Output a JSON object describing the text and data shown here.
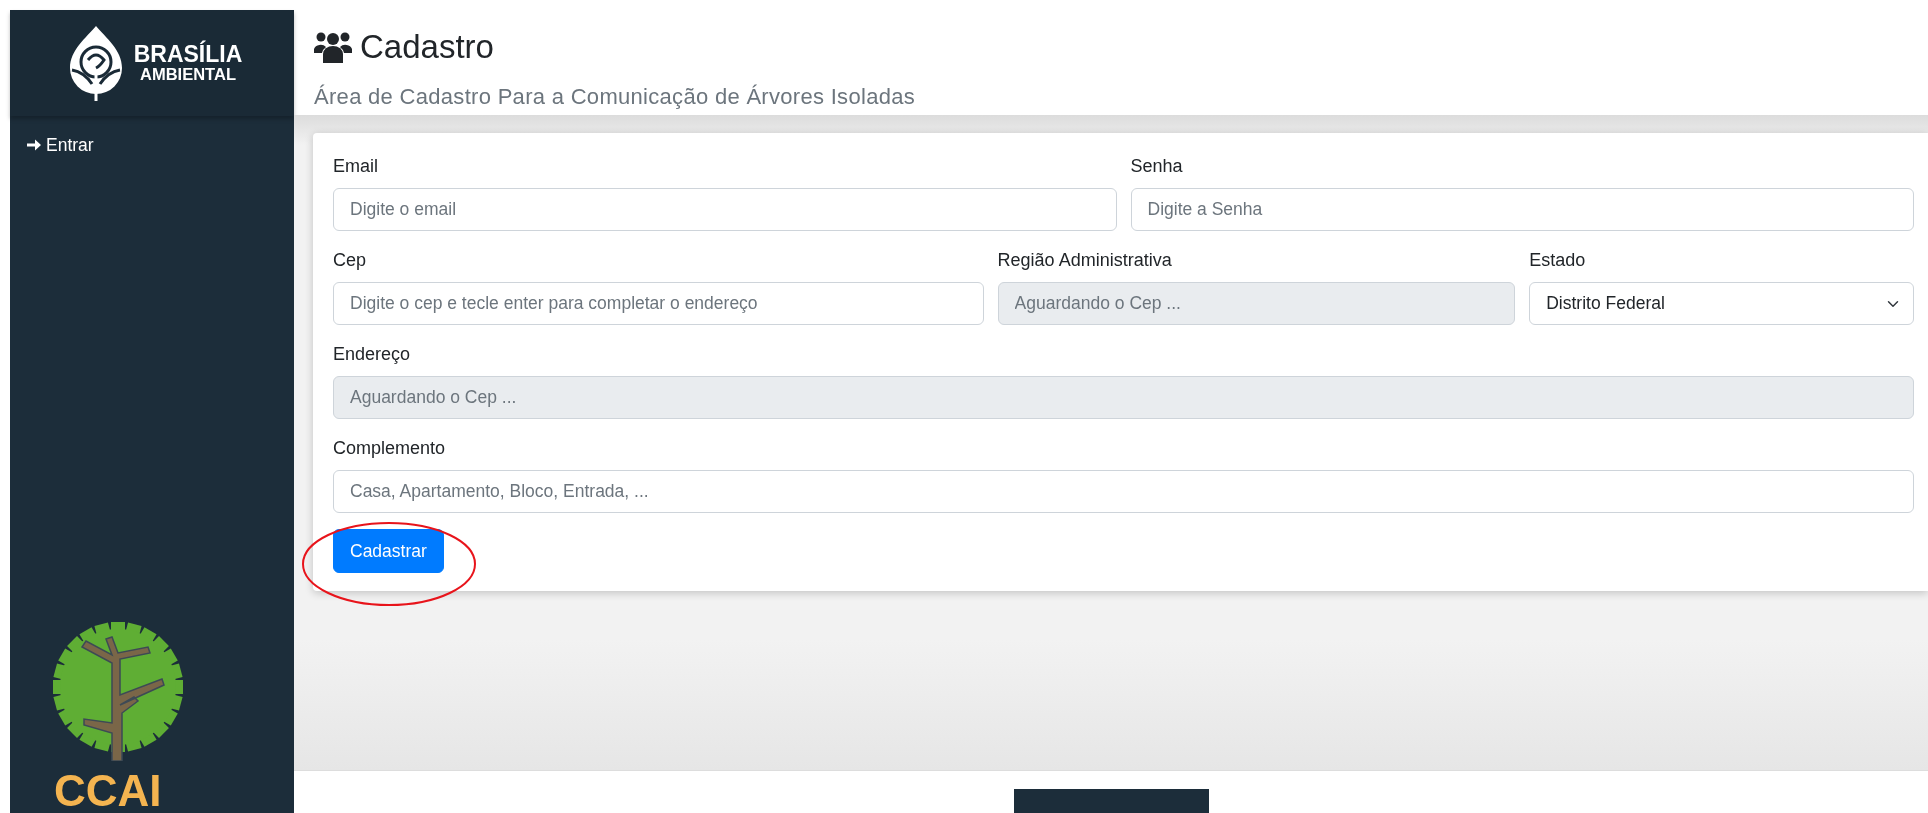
{
  "sidebar": {
    "brand": {
      "line_1": "BRASÍLIA",
      "line_2": "AMBIENTAL"
    },
    "items": [
      {
        "label": "Entrar",
        "selected": false
      }
    ],
    "bottom_logo": {
      "text": "CCAI"
    }
  },
  "header": {
    "title": "Cadastro",
    "subtitle": "Área de Cadastro Para a Comunicação de Árvores Isoladas"
  },
  "form": {
    "rows": [
      [
        {
          "label": "Email",
          "kind": "input",
          "placeholder": "Digite o email",
          "disabled": false
        },
        {
          "label": "Senha",
          "kind": "input",
          "placeholder": "Digite a Senha",
          "disabled": false
        }
      ],
      [
        {
          "label": "Cep",
          "kind": "input",
          "placeholder": "Digite o cep e tecle enter para completar o endereço",
          "disabled": false
        },
        {
          "label": "Região Administrativa",
          "kind": "input",
          "placeholder": "Aguardando o Cep ...",
          "disabled": true
        },
        {
          "label": "Estado",
          "kind": "select",
          "value": "Distrito Federal",
          "disabled": false
        }
      ],
      [
        {
          "label": "Endereço",
          "kind": "input",
          "placeholder": "Aguardando o Cep ...",
          "disabled": true
        }
      ],
      [
        {
          "label": "Complemento",
          "kind": "input",
          "placeholder": "Casa, Apartamento, Bloco, Entrada, ...",
          "disabled": false
        }
      ]
    ],
    "submit": {
      "label": "Cadastrar",
      "circled": true
    }
  }
}
